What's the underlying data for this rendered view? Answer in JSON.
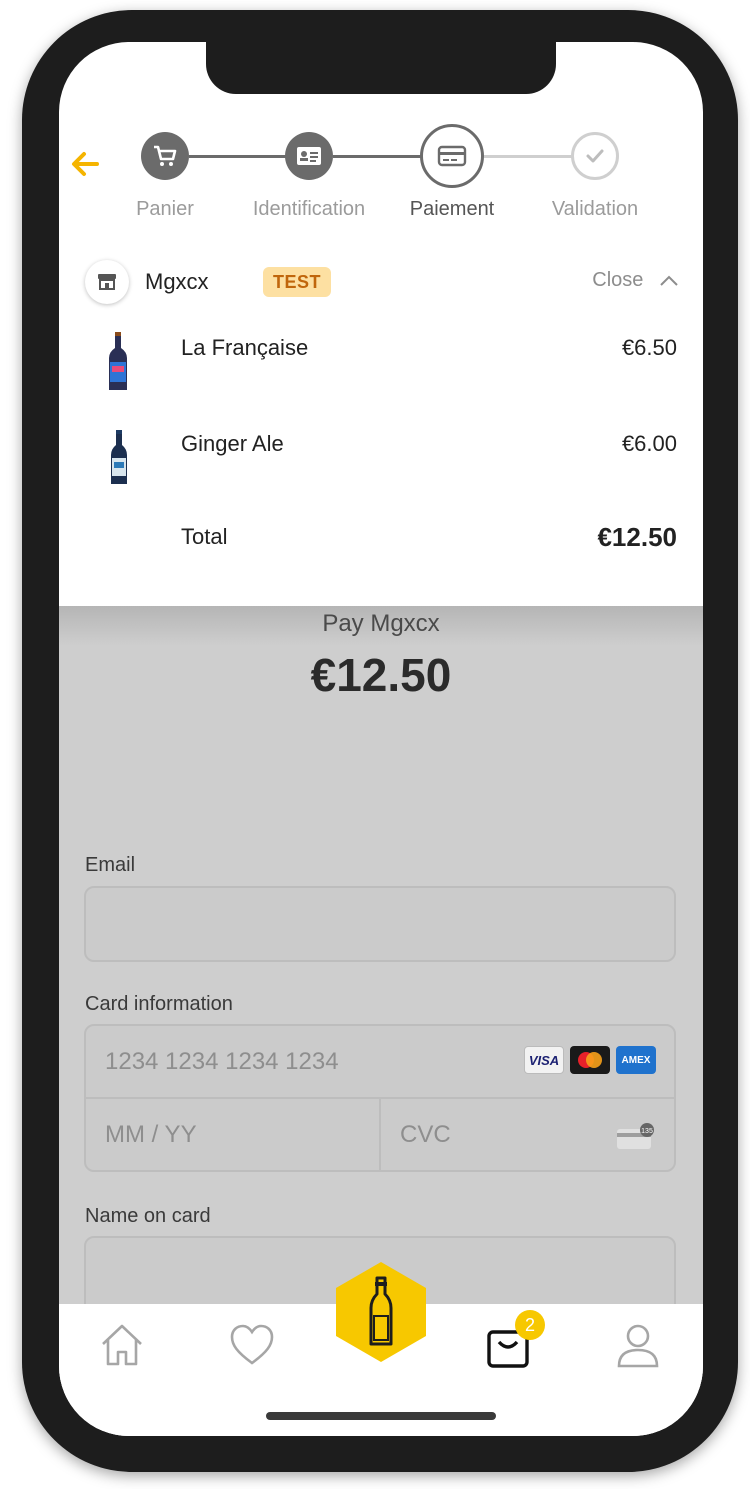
{
  "steps": [
    {
      "label": "Panier",
      "state": "done",
      "icon": "cart-icon"
    },
    {
      "label": "Identification",
      "state": "done",
      "icon": "id-card-icon"
    },
    {
      "label": "Paiement",
      "state": "current",
      "icon": "credit-card-icon"
    },
    {
      "label": "Validation",
      "state": "pending",
      "icon": "check-icon"
    }
  ],
  "shop": {
    "name": "Mgxcx",
    "badge": "TEST",
    "toggle_label": "Close"
  },
  "items": [
    {
      "name": "La Française",
      "price": "€6.50"
    },
    {
      "name": "Ginger Ale",
      "price": "€6.00"
    }
  ],
  "total": {
    "label": "Total",
    "value": "€12.50"
  },
  "payment": {
    "pay_label": "Pay Mgxcx",
    "amount": "€12.50",
    "email_label": "Email",
    "email_placeholder": "",
    "card_label": "Card information",
    "card_number_placeholder": "1234 1234 1234 1234",
    "expiry_placeholder": "MM / YY",
    "cvc_placeholder": "CVC",
    "name_label": "Name on card",
    "card_brands": [
      "VISA",
      "Mastercard",
      "AMEX"
    ]
  },
  "tabbar": {
    "cart_count": "2",
    "items": [
      "home-icon",
      "heart-icon",
      "bottle-icon",
      "shopping-bag-icon",
      "user-icon"
    ]
  },
  "colors": {
    "accent": "#f7c800",
    "back_arrow": "#f5b400",
    "step_done": "#6b6b6b",
    "step_pending": "#cfcfcf",
    "badge_bg": "#fde0a2",
    "badge_text": "#c0660c"
  }
}
